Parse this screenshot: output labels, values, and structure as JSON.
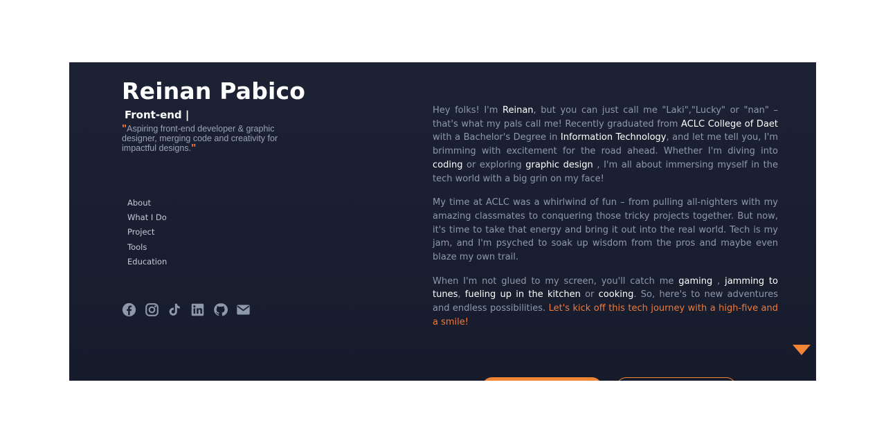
{
  "profile": {
    "name": "Reinan Pabico",
    "role": "Front-end |",
    "tagline": "Aspiring front-end developer & graphic designer, merging code and creativity for impactful designs.",
    "quote_open": "\"",
    "quote_close": "\""
  },
  "nav": {
    "items": [
      {
        "label": "About"
      },
      {
        "label": "What I Do"
      },
      {
        "label": "Project"
      },
      {
        "label": "Tools"
      },
      {
        "label": "Education"
      }
    ]
  },
  "socials": [
    {
      "icon": "facebook-icon"
    },
    {
      "icon": "instagram-icon"
    },
    {
      "icon": "tiktok-icon"
    },
    {
      "icon": "linkedin-icon"
    },
    {
      "icon": "github-icon"
    },
    {
      "icon": "mail-icon"
    }
  ],
  "about": {
    "p1": [
      {
        "t": "Hey folks! I'm ",
        "s": "n"
      },
      {
        "t": "Reinan",
        "s": "h"
      },
      {
        "t": ", but you can just call me \"Laki\",\"Lucky\" or \"nan\" – that's what my pals call me! Recently graduated from ",
        "s": "n"
      },
      {
        "t": "ACLC College of Daet",
        "s": "h"
      },
      {
        "t": " with a Bachelor's Degree in ",
        "s": "n"
      },
      {
        "t": "Information Technology",
        "s": "h"
      },
      {
        "t": ", and let me tell you, I'm brimming with excitement for the road ahead. Whether I'm diving into ",
        "s": "n"
      },
      {
        "t": "coding",
        "s": "h"
      },
      {
        "t": " or exploring ",
        "s": "n"
      },
      {
        "t": "graphic design",
        "s": "h"
      },
      {
        "t": " , I'm all about immersing myself in the tech world with a big grin on my face!",
        "s": "n"
      }
    ],
    "p2": [
      {
        "t": "My time at ACLC was a whirlwind of fun – from pulling all-nighters with my amazing classmates to conquering those tricky projects together. But now, it's time to take that energy and bring it out into the real world. Tech is my jam, and I'm psyched to soak up wisdom from the pros and maybe even blaze my own trail.",
        "s": "n"
      }
    ],
    "p3": [
      {
        "t": "When I'm not glued to my screen, you'll catch me ",
        "s": "n"
      },
      {
        "t": "gaming",
        "s": "h"
      },
      {
        "t": " , ",
        "s": "n"
      },
      {
        "t": "jamming to tunes",
        "s": "h"
      },
      {
        "t": ", ",
        "s": "n"
      },
      {
        "t": "fueling up in the kitchen",
        "s": "h"
      },
      {
        "t": " or ",
        "s": "n"
      },
      {
        "t": "cooking",
        "s": "h"
      },
      {
        "t": ". So, here's to new adventures and endless possibilities. ",
        "s": "n"
      },
      {
        "t": "Let's kick off this tech journey with a high-five and a smile!",
        "s": "a"
      }
    ]
  },
  "colors": {
    "background": "#1c2234",
    "accent": "#f28535",
    "text_muted": "#8e98ad",
    "text_highlight": "#ffffff"
  }
}
